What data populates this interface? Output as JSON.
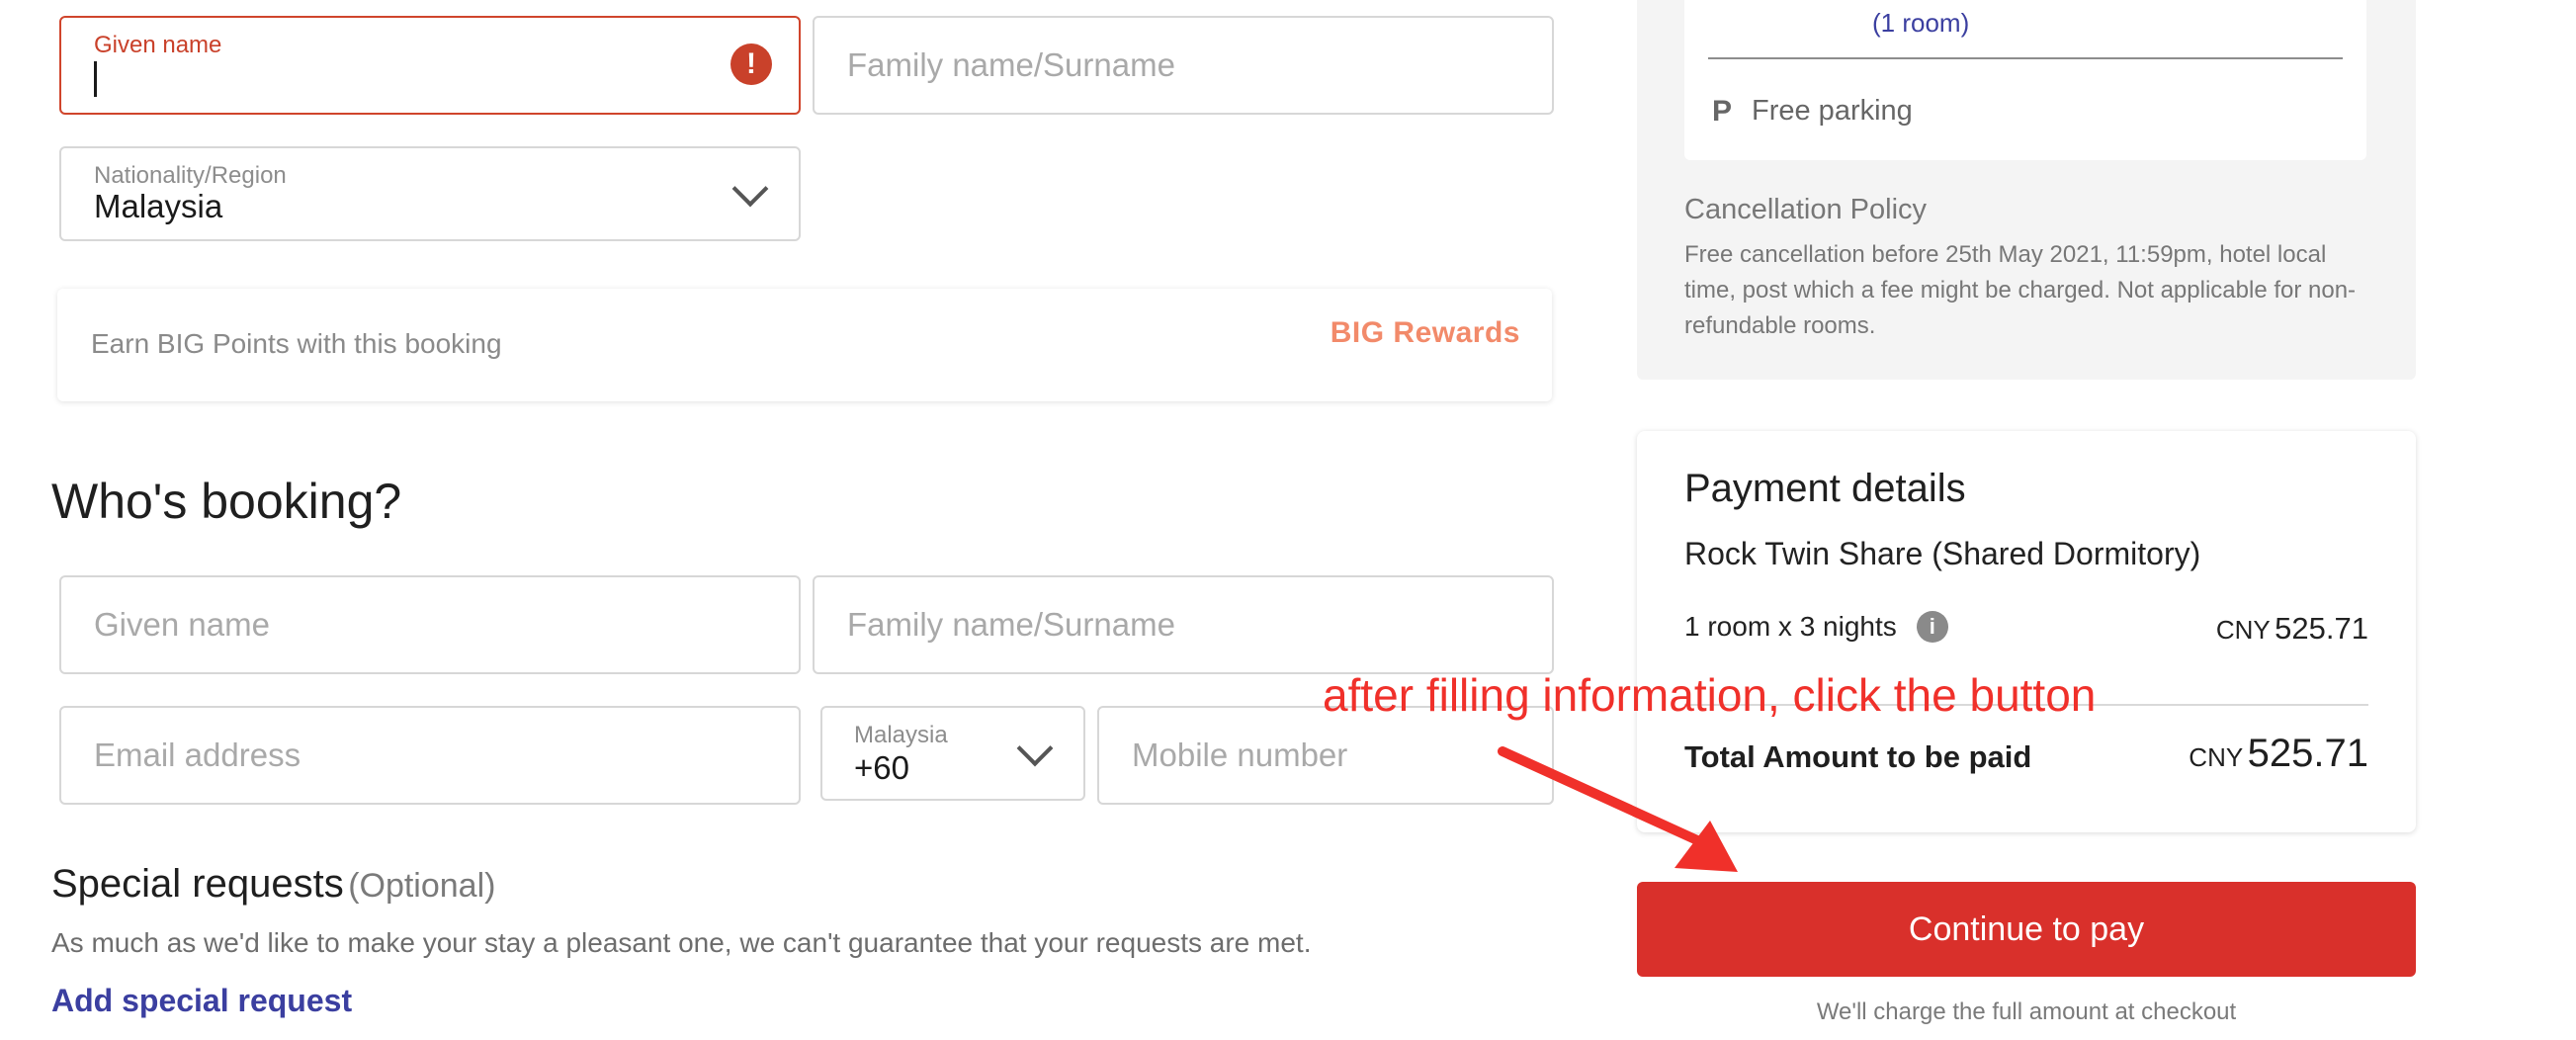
{
  "guest": {
    "given_name_label": "Given name",
    "given_name_value": "",
    "error_icon": "!",
    "family_name_placeholder": "Family name/Surname",
    "nationality_label": "Nationality/Region",
    "nationality_value": "Malaysia"
  },
  "rewards": {
    "text": "Earn BIG Points with this booking",
    "logo_text": "BIG Rewards"
  },
  "booking": {
    "title": "Who's booking?",
    "given_name_placeholder": "Given name",
    "family_name_placeholder": "Family name/Surname",
    "email_placeholder": "Email address",
    "country_label": "Malaysia",
    "country_code": "+60",
    "mobile_placeholder": "Mobile number"
  },
  "special": {
    "title": "Special requests",
    "optional": "(Optional)",
    "description": "As much as we'd like to make your stay a pleasant one, we can't guarantee that your requests are met.",
    "add_link": "Add special request"
  },
  "summary": {
    "rooms_note": "(1 room)",
    "parking_icon": "P",
    "parking": "Free parking",
    "cancel_title": "Cancellation Policy",
    "cancel_text": "Free cancellation before 25th May 2021, 11:59pm, hotel local time, post which a fee might be charged. Not applicable for non-refundable rooms."
  },
  "payment": {
    "title": "Payment details",
    "room_name": "Rock Twin Share (Shared Dormitory)",
    "nights": "1 room x 3 nights",
    "info_icon": "i",
    "currency": "CNY",
    "line_amount": "525.71",
    "total_label": "Total Amount to be paid",
    "total_currency": "CNY",
    "total_amount": "525.71",
    "continue_label": "Continue to pay",
    "charge_note": "We'll charge the full amount at checkout"
  },
  "annotation": {
    "text": "after filling information, click the button",
    "color": "#f0302a"
  },
  "colors": {
    "accent_red": "#d9302b",
    "error_red": "#c9412a",
    "link_blue": "#3b3fa0"
  }
}
